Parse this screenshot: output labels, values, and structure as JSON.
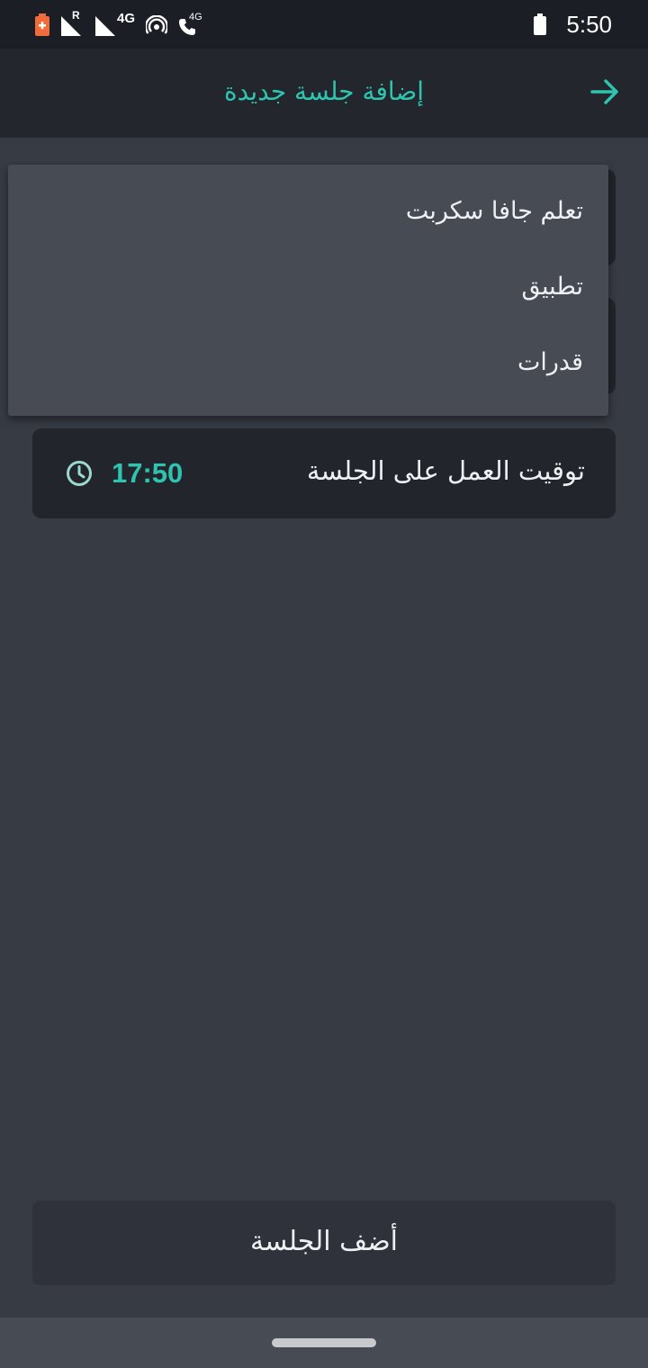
{
  "status_bar": {
    "network_type_1": "4G",
    "network_type_2": "4G",
    "roaming_indicator": "R",
    "time": "5:50",
    "icons": [
      "battery-saver-icon",
      "signal-roaming-icon",
      "signal-icon",
      "hotspot-icon",
      "volte-call-icon",
      "battery-icon"
    ],
    "colors": {
      "battery_saver": "#f26b3a",
      "icon": "#ffffff"
    }
  },
  "app_bar": {
    "title": "إضافة جلسة جديدة",
    "back_icon": "arrow-right-icon"
  },
  "dropdown": {
    "options": [
      {
        "label": "تعلم جافا سكربت"
      },
      {
        "label": "تطبيق"
      },
      {
        "label": "قدرات"
      }
    ]
  },
  "session_time": {
    "label": "توقيت العمل على الجلسة",
    "value": "17:50",
    "icon": "clock-icon"
  },
  "add_button": {
    "label": "أضف الجلسة"
  },
  "colors": {
    "accent": "#2ec4b0",
    "background": "#373b44",
    "surface": "#22252c",
    "menu": "#464b54"
  }
}
